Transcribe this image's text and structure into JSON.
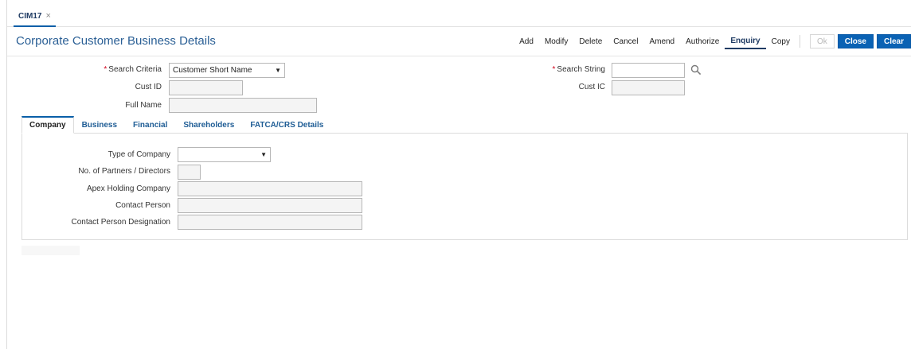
{
  "tab": {
    "label": "CIM17",
    "close": "×"
  },
  "page": {
    "title": "Corporate Customer Business Details"
  },
  "toolbar": {
    "items": [
      "Add",
      "Modify",
      "Delete",
      "Cancel",
      "Amend",
      "Authorize",
      "Enquiry",
      "Copy"
    ],
    "active": "Enquiry",
    "buttons": {
      "ok": "Ok",
      "close": "Close",
      "clear": "Clear"
    }
  },
  "search": {
    "criteria_label": "Search Criteria",
    "criteria_value": "Customer Short Name",
    "string_label": "Search String",
    "string_value": "",
    "required_mark": "*",
    "cust_id_label": "Cust ID",
    "cust_id_value": "",
    "cust_ic_label": "Cust IC",
    "cust_ic_value": "",
    "full_name_label": "Full Name",
    "full_name_value": ""
  },
  "subtabs": [
    "Company",
    "Business",
    "Financial",
    "Shareholders",
    "FATCA/CRS Details"
  ],
  "company": {
    "type_label": "Type of Company",
    "type_value": "",
    "partners_label": "No. of Partners / Directors",
    "partners_value": "",
    "apex_label": "Apex Holding Company",
    "apex_value": "",
    "contact_label": "Contact Person",
    "contact_value": "",
    "designation_label": "Contact Person Designation",
    "designation_value": ""
  },
  "icons": {
    "search": "search-icon",
    "dropdown": "chevron-down-icon",
    "close": "close-icon"
  },
  "colors": {
    "accent": "#0a62b4",
    "title": "#2a5f95",
    "required": "#d0021b"
  }
}
